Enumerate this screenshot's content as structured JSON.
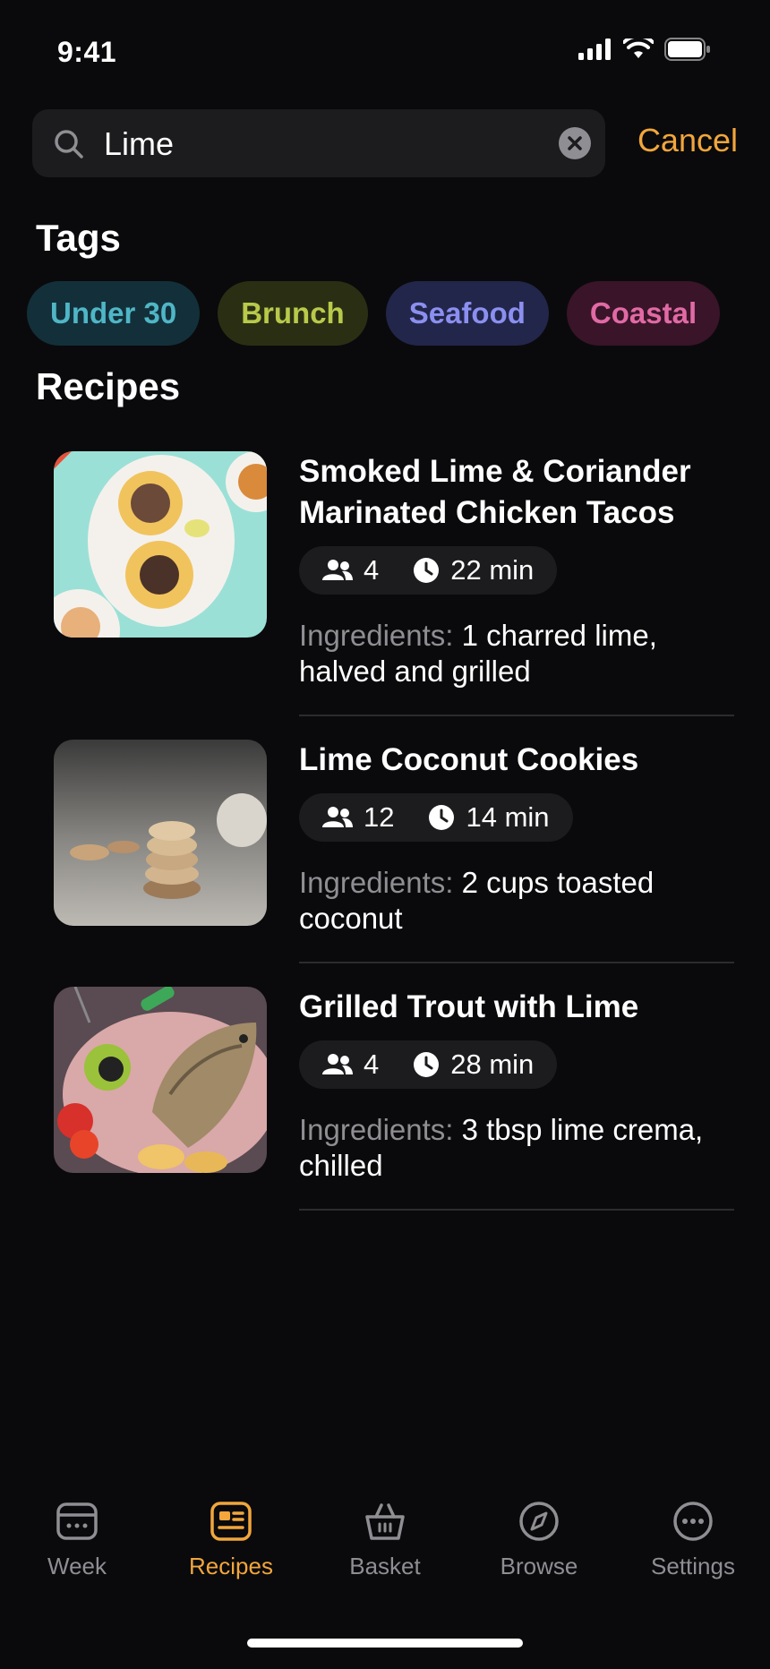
{
  "status": {
    "time": "9:41"
  },
  "search": {
    "value": "Lime",
    "placeholder": "Search",
    "cancel_label": "Cancel"
  },
  "tags": {
    "title": "Tags",
    "items": [
      {
        "label": "Under 30",
        "text_color": "#4fb6c6",
        "bg_color": "#13303a"
      },
      {
        "label": "Brunch",
        "text_color": "#b9c94a",
        "bg_color": "#2a2f14"
      },
      {
        "label": "Seafood",
        "text_color": "#8b8ff0",
        "bg_color": "#22264a"
      },
      {
        "label": "Coastal",
        "text_color": "#e06aa5",
        "bg_color": "#3a1428"
      }
    ]
  },
  "recipes": {
    "title": "Recipes",
    "items": [
      {
        "title": "Smoked Lime & Coriander Marinated Chicken Tacos",
        "servings": "4",
        "time": "22 min",
        "ingredients_label": "Ingredients:",
        "ingredients_text": " 1 charred lime, halved and grilled",
        "image": "tacos-photo"
      },
      {
        "title": "Lime Coconut Cookies",
        "servings": "12",
        "time": "14 min",
        "ingredients_label": "Ingredients:",
        "ingredients_text": " 2 cups toasted coconut",
        "image": "cookies-photo"
      },
      {
        "title": "Grilled Trout with Lime",
        "servings": "4",
        "time": "28 min",
        "ingredients_label": "Ingredients:",
        "ingredients_text": " 3 tbsp lime crema, chilled",
        "image": "trout-photo"
      }
    ]
  },
  "tab_bar": {
    "active_color": "#f2a63b",
    "inactive_color": "#8e8e93",
    "items": [
      {
        "label": "Week",
        "icon": "calendar-icon",
        "active": false
      },
      {
        "label": "Recipes",
        "icon": "recipe-card-icon",
        "active": true
      },
      {
        "label": "Basket",
        "icon": "basket-icon",
        "active": false
      },
      {
        "label": "Browse",
        "icon": "compass-icon",
        "active": false
      },
      {
        "label": "Settings",
        "icon": "ellipsis-circle-icon",
        "active": false
      }
    ]
  }
}
